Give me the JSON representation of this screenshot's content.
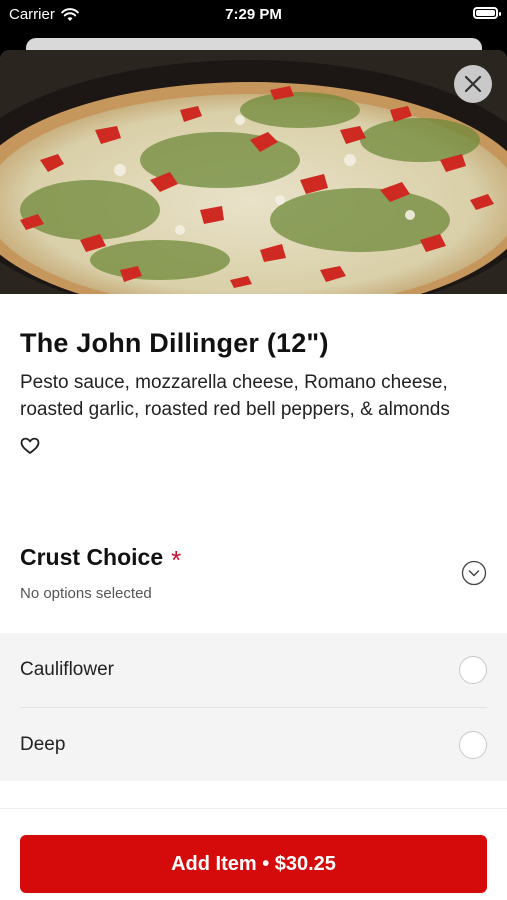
{
  "status_bar": {
    "carrier": "Carrier",
    "time": "7:29 PM"
  },
  "item": {
    "name": "The John Dillinger (12\")",
    "description": "Pesto sauce, mozzarella cheese, Romano cheese, roasted garlic, roasted red bell peppers, & almonds",
    "image_icon": "pizza-photo"
  },
  "crust": {
    "title": "Crust Choice",
    "required_marker": "*",
    "status": "No options selected",
    "options": [
      {
        "label": "Cauliflower"
      },
      {
        "label": "Deep"
      }
    ]
  },
  "footer": {
    "add_button_label": "Add Item • $30.25"
  },
  "colors": {
    "accent": "#d50a0a",
    "required": "#c8102e"
  }
}
